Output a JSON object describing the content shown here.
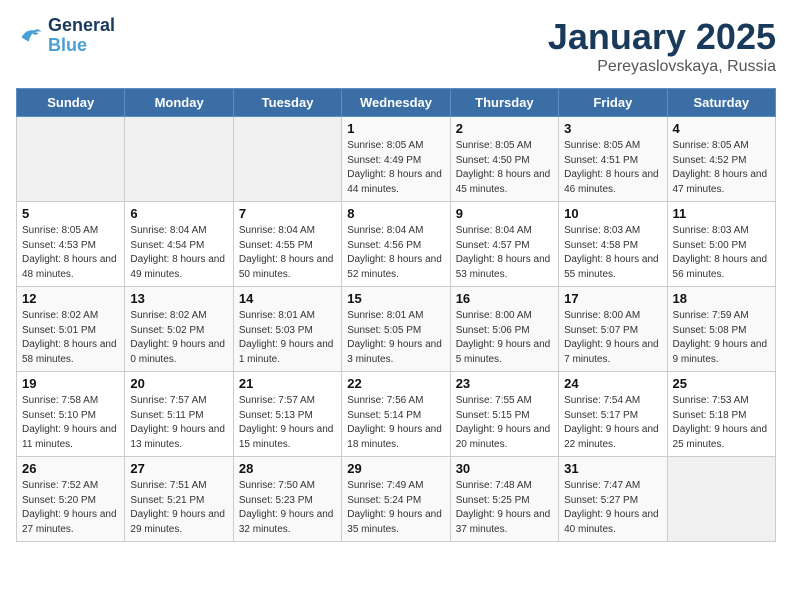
{
  "logo": {
    "line1": "General",
    "line2": "Blue"
  },
  "title": "January 2025",
  "subtitle": "Pereyaslovskaya, Russia",
  "weekdays": [
    "Sunday",
    "Monday",
    "Tuesday",
    "Wednesday",
    "Thursday",
    "Friday",
    "Saturday"
  ],
  "weeks": [
    [
      {
        "day": "",
        "sunrise": "",
        "sunset": "",
        "daylight": ""
      },
      {
        "day": "",
        "sunrise": "",
        "sunset": "",
        "daylight": ""
      },
      {
        "day": "",
        "sunrise": "",
        "sunset": "",
        "daylight": ""
      },
      {
        "day": "1",
        "sunrise": "Sunrise: 8:05 AM",
        "sunset": "Sunset: 4:49 PM",
        "daylight": "Daylight: 8 hours and 44 minutes."
      },
      {
        "day": "2",
        "sunrise": "Sunrise: 8:05 AM",
        "sunset": "Sunset: 4:50 PM",
        "daylight": "Daylight: 8 hours and 45 minutes."
      },
      {
        "day": "3",
        "sunrise": "Sunrise: 8:05 AM",
        "sunset": "Sunset: 4:51 PM",
        "daylight": "Daylight: 8 hours and 46 minutes."
      },
      {
        "day": "4",
        "sunrise": "Sunrise: 8:05 AM",
        "sunset": "Sunset: 4:52 PM",
        "daylight": "Daylight: 8 hours and 47 minutes."
      }
    ],
    [
      {
        "day": "5",
        "sunrise": "Sunrise: 8:05 AM",
        "sunset": "Sunset: 4:53 PM",
        "daylight": "Daylight: 8 hours and 48 minutes."
      },
      {
        "day": "6",
        "sunrise": "Sunrise: 8:04 AM",
        "sunset": "Sunset: 4:54 PM",
        "daylight": "Daylight: 8 hours and 49 minutes."
      },
      {
        "day": "7",
        "sunrise": "Sunrise: 8:04 AM",
        "sunset": "Sunset: 4:55 PM",
        "daylight": "Daylight: 8 hours and 50 minutes."
      },
      {
        "day": "8",
        "sunrise": "Sunrise: 8:04 AM",
        "sunset": "Sunset: 4:56 PM",
        "daylight": "Daylight: 8 hours and 52 minutes."
      },
      {
        "day": "9",
        "sunrise": "Sunrise: 8:04 AM",
        "sunset": "Sunset: 4:57 PM",
        "daylight": "Daylight: 8 hours and 53 minutes."
      },
      {
        "day": "10",
        "sunrise": "Sunrise: 8:03 AM",
        "sunset": "Sunset: 4:58 PM",
        "daylight": "Daylight: 8 hours and 55 minutes."
      },
      {
        "day": "11",
        "sunrise": "Sunrise: 8:03 AM",
        "sunset": "Sunset: 5:00 PM",
        "daylight": "Daylight: 8 hours and 56 minutes."
      }
    ],
    [
      {
        "day": "12",
        "sunrise": "Sunrise: 8:02 AM",
        "sunset": "Sunset: 5:01 PM",
        "daylight": "Daylight: 8 hours and 58 minutes."
      },
      {
        "day": "13",
        "sunrise": "Sunrise: 8:02 AM",
        "sunset": "Sunset: 5:02 PM",
        "daylight": "Daylight: 9 hours and 0 minutes."
      },
      {
        "day": "14",
        "sunrise": "Sunrise: 8:01 AM",
        "sunset": "Sunset: 5:03 PM",
        "daylight": "Daylight: 9 hours and 1 minute."
      },
      {
        "day": "15",
        "sunrise": "Sunrise: 8:01 AM",
        "sunset": "Sunset: 5:05 PM",
        "daylight": "Daylight: 9 hours and 3 minutes."
      },
      {
        "day": "16",
        "sunrise": "Sunrise: 8:00 AM",
        "sunset": "Sunset: 5:06 PM",
        "daylight": "Daylight: 9 hours and 5 minutes."
      },
      {
        "day": "17",
        "sunrise": "Sunrise: 8:00 AM",
        "sunset": "Sunset: 5:07 PM",
        "daylight": "Daylight: 9 hours and 7 minutes."
      },
      {
        "day": "18",
        "sunrise": "Sunrise: 7:59 AM",
        "sunset": "Sunset: 5:08 PM",
        "daylight": "Daylight: 9 hours and 9 minutes."
      }
    ],
    [
      {
        "day": "19",
        "sunrise": "Sunrise: 7:58 AM",
        "sunset": "Sunset: 5:10 PM",
        "daylight": "Daylight: 9 hours and 11 minutes."
      },
      {
        "day": "20",
        "sunrise": "Sunrise: 7:57 AM",
        "sunset": "Sunset: 5:11 PM",
        "daylight": "Daylight: 9 hours and 13 minutes."
      },
      {
        "day": "21",
        "sunrise": "Sunrise: 7:57 AM",
        "sunset": "Sunset: 5:13 PM",
        "daylight": "Daylight: 9 hours and 15 minutes."
      },
      {
        "day": "22",
        "sunrise": "Sunrise: 7:56 AM",
        "sunset": "Sunset: 5:14 PM",
        "daylight": "Daylight: 9 hours and 18 minutes."
      },
      {
        "day": "23",
        "sunrise": "Sunrise: 7:55 AM",
        "sunset": "Sunset: 5:15 PM",
        "daylight": "Daylight: 9 hours and 20 minutes."
      },
      {
        "day": "24",
        "sunrise": "Sunrise: 7:54 AM",
        "sunset": "Sunset: 5:17 PM",
        "daylight": "Daylight: 9 hours and 22 minutes."
      },
      {
        "day": "25",
        "sunrise": "Sunrise: 7:53 AM",
        "sunset": "Sunset: 5:18 PM",
        "daylight": "Daylight: 9 hours and 25 minutes."
      }
    ],
    [
      {
        "day": "26",
        "sunrise": "Sunrise: 7:52 AM",
        "sunset": "Sunset: 5:20 PM",
        "daylight": "Daylight: 9 hours and 27 minutes."
      },
      {
        "day": "27",
        "sunrise": "Sunrise: 7:51 AM",
        "sunset": "Sunset: 5:21 PM",
        "daylight": "Daylight: 9 hours and 29 minutes."
      },
      {
        "day": "28",
        "sunrise": "Sunrise: 7:50 AM",
        "sunset": "Sunset: 5:23 PM",
        "daylight": "Daylight: 9 hours and 32 minutes."
      },
      {
        "day": "29",
        "sunrise": "Sunrise: 7:49 AM",
        "sunset": "Sunset: 5:24 PM",
        "daylight": "Daylight: 9 hours and 35 minutes."
      },
      {
        "day": "30",
        "sunrise": "Sunrise: 7:48 AM",
        "sunset": "Sunset: 5:25 PM",
        "daylight": "Daylight: 9 hours and 37 minutes."
      },
      {
        "day": "31",
        "sunrise": "Sunrise: 7:47 AM",
        "sunset": "Sunset: 5:27 PM",
        "daylight": "Daylight: 9 hours and 40 minutes."
      },
      {
        "day": "",
        "sunrise": "",
        "sunset": "",
        "daylight": ""
      }
    ]
  ]
}
